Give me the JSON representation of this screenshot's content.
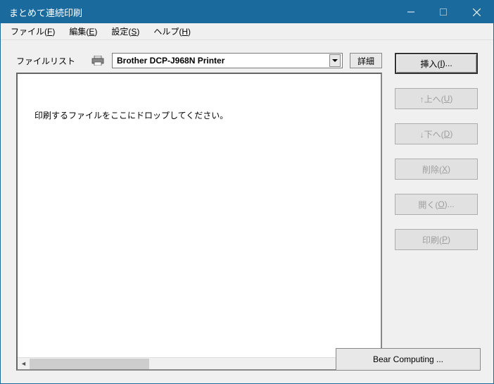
{
  "title": "まとめて連続印刷",
  "menu": {
    "file": "ファイル(F)",
    "edit": "編集(E)",
    "settings": "設定(S)",
    "help": "ヘルプ(H)"
  },
  "labels": {
    "filelist": "ファイルリスト"
  },
  "printer": {
    "selected": "Brother DCP-J968N Printer"
  },
  "buttons": {
    "details": "詳細",
    "insert": "挿入(I)...",
    "up": "↑上へ(U)",
    "down": "↓下へ(D)",
    "delete": "削除(X)",
    "open": "開く(O)...",
    "print": "印刷(P)"
  },
  "placeholder": "印刷するファイルをここにドロップしてください。",
  "footer": {
    "brand": "Bear Computing ..."
  }
}
